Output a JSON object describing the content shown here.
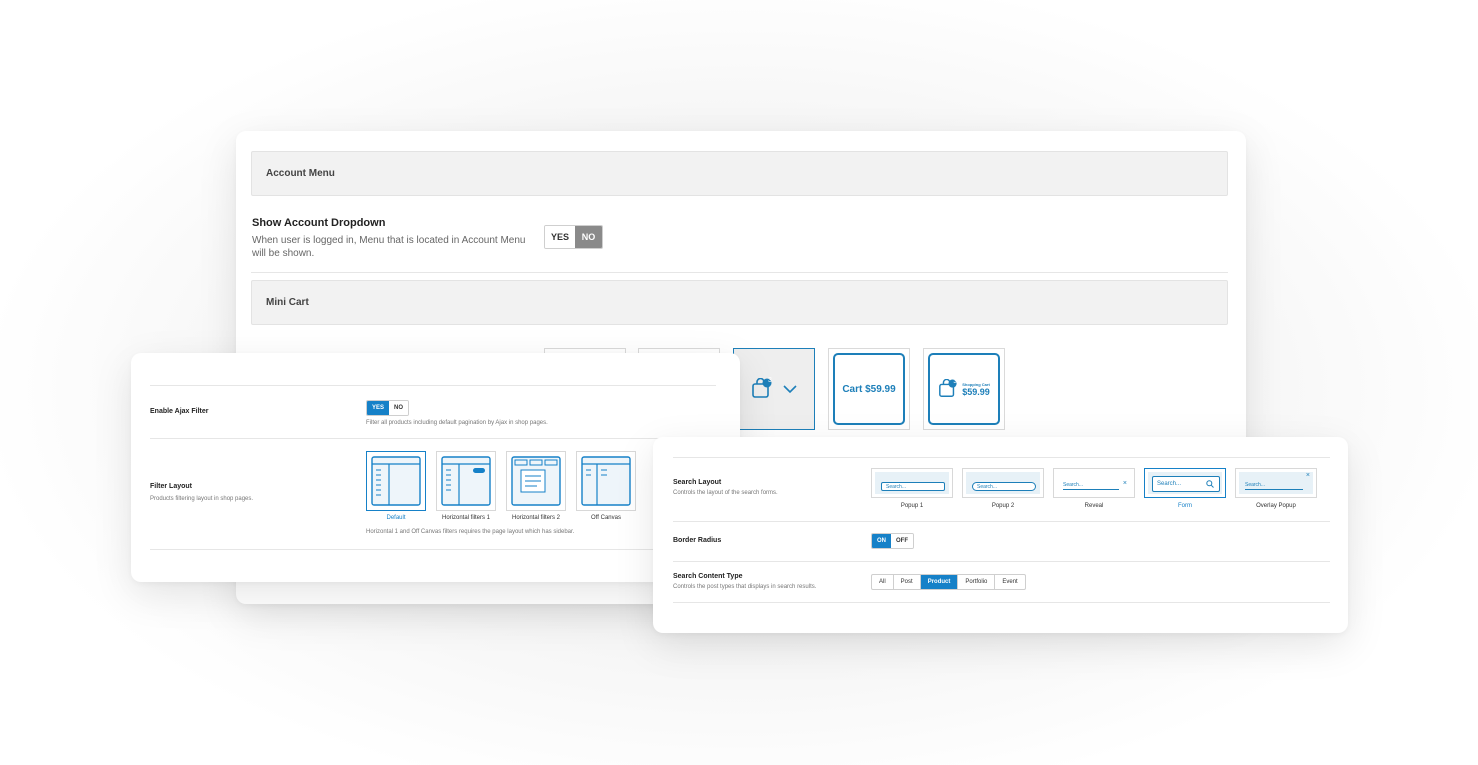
{
  "back_panel": {
    "account_menu": {
      "heading": "Account Menu"
    },
    "show_account_dropdown": {
      "title": "Show Account Dropdown",
      "description_line1": "When user is logged in, Menu that is located in Account Menu",
      "description_line2": "will be shown.",
      "yes_label": "YES",
      "no_label": "NO",
      "selected": "NO"
    },
    "mini_cart": {
      "heading": "Mini Cart",
      "options": [
        {
          "type": "icon-count-dropdown",
          "count": "3"
        },
        {
          "type": "text-total",
          "label": "Cart $59.99"
        },
        {
          "type": "icon-text-total",
          "count": "3",
          "label_small": "Shopping Cart",
          "label_total": "$59.99"
        }
      ]
    }
  },
  "left_panel": {
    "ajax_filter": {
      "title": "Enable Ajax Filter",
      "yes_label": "YES",
      "no_label": "NO",
      "selected": "YES",
      "description": "Filter all products including default pagination by Ajax in shop pages."
    },
    "filter_layout": {
      "title": "Filter Layout",
      "description": "Products filtering layout in shop pages.",
      "options": [
        "Default",
        "Horizontal filters 1",
        "Horizontal filters 2",
        "Off Canvas"
      ],
      "selected": "Default",
      "note": "Horizontal 1 and Off Canvas filters requires the page layout which has sidebar."
    }
  },
  "right_panel": {
    "search_layout": {
      "title": "Search Layout",
      "description": "Controls the layout of the search forms.",
      "options": [
        "Popup 1",
        "Popup 2",
        "Reveal",
        "Form",
        "Overlay Popup"
      ],
      "selected": "Form",
      "search_placeholder": "Search..."
    },
    "border_radius": {
      "title": "Border Radius",
      "on_label": "ON",
      "off_label": "OFF",
      "selected": "ON"
    },
    "search_content_type": {
      "title": "Search Content Type",
      "description": "Controls the post types that displays in search results.",
      "options": [
        "All",
        "Post",
        "Product",
        "Portfolio",
        "Event"
      ],
      "selected": "Product"
    }
  },
  "colors": {
    "accent": "#1681c8",
    "accent_dark": "#1d7fb9",
    "section_bg": "#f2f2f2",
    "toggle_selected_gray": "#8a8a8a"
  }
}
